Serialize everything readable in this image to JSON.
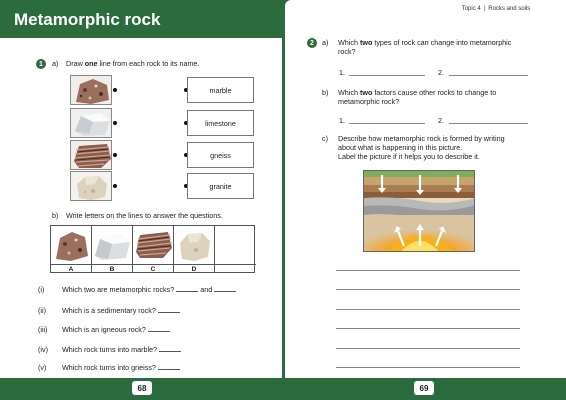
{
  "left_page": {
    "title": "Metamorphic rock",
    "page_number": "68",
    "q1": {
      "number": "1",
      "a_label": "a)",
      "a_text_pre": "Draw ",
      "a_text_bold": "one",
      "a_text_post": " line from each rock to its name.",
      "rock_names": [
        "marble",
        "limestone",
        "gneiss",
        "granite"
      ],
      "b_label": "b)",
      "b_text": "Write letters on the lines to answer the questions.",
      "table_labels": [
        "A",
        "B",
        "C",
        "D"
      ],
      "questions": [
        {
          "num": "(i)",
          "text": "Which two are metamorphic rocks?",
          "suffix": "and"
        },
        {
          "num": "(ii)",
          "text": "Which is a sedimentary rock?"
        },
        {
          "num": "(iii)",
          "text": "Which is an igneous rock?"
        },
        {
          "num": "(iv)",
          "text": "Which rock turns into marble?"
        },
        {
          "num": "(v)",
          "text": "Which rock turns into gneiss?"
        }
      ]
    }
  },
  "right_page": {
    "topic_tab": {
      "topic": "Topic 4",
      "section": "Rocks and soils"
    },
    "page_number": "69",
    "q2": {
      "number": "2",
      "a_label": "a)",
      "a_line1_pre": "Which ",
      "a_line1_bold": "two",
      "a_line1_post": " types of rock can change into metamorphic",
      "a_line2": "rock?",
      "b_label": "b)",
      "b_line1_pre": "Which ",
      "b_line1_bold": "two",
      "b_line1_post": " factors cause other rocks to change to",
      "b_line2": "metamorphic rock?",
      "c_label": "c)",
      "c_lines": [
        "Describe how metamorphic rock is formed by writing",
        "about what is happening in this picture.",
        "Label the picture if it helps you to describe it."
      ],
      "answer_nums": [
        "1.",
        "2."
      ]
    }
  },
  "colors": {
    "brand_green": "#2c6b3e"
  }
}
